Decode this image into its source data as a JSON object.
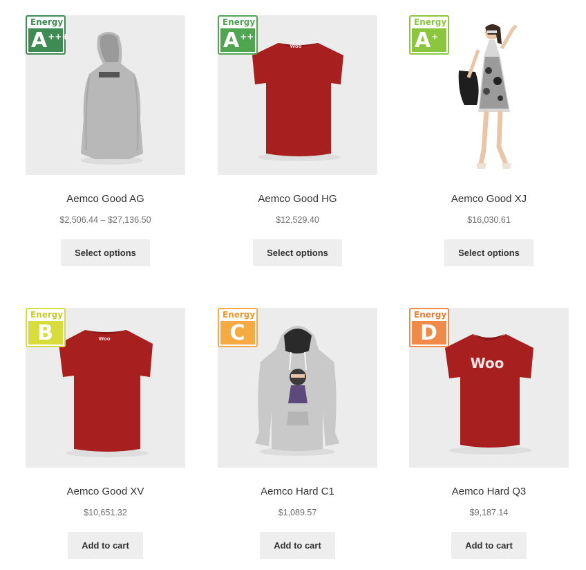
{
  "products": [
    {
      "name": "Aemco Good AG",
      "price": "$2,506.44 – $27,136.50",
      "button": "Select options",
      "energy_word": "Energy",
      "energy_class": "A",
      "energy_plus": "+++",
      "badge_color": "#3e8c53",
      "image": "grey-hoodie-back-icon"
    },
    {
      "name": "Aemco Good HG",
      "price": "$12,529.40",
      "button": "Select options",
      "energy_word": "Energy",
      "energy_class": "A",
      "energy_plus": "++",
      "badge_color": "#4fa550",
      "image": "red-tshirt-back-icon"
    },
    {
      "name": "Aemco Good XJ",
      "price": "$16,030.61",
      "button": "Select options",
      "energy_word": "Energy",
      "energy_class": "A",
      "energy_plus": "+",
      "badge_color": "#8cc63f",
      "image": "model-dress-icon"
    },
    {
      "name": "Aemco Good XV",
      "price": "$10,651.32",
      "button": "Add to cart",
      "energy_word": "Energy",
      "energy_class": "B",
      "energy_plus": "",
      "badge_color": "#d7de3c",
      "image": "red-tshirt-back-icon"
    },
    {
      "name": "Aemco Hard C1",
      "price": "$1,089.57",
      "button": "Add to cart",
      "energy_word": "Energy",
      "energy_class": "C",
      "energy_plus": "",
      "badge_color": "#f7a944",
      "image": "grey-hoodie-ninja-icon"
    },
    {
      "name": "Aemco Hard Q3",
      "price": "$9,187.14",
      "button": "Add to cart",
      "energy_word": "Energy",
      "energy_class": "D",
      "energy_plus": "",
      "badge_color": "#ef8a4a",
      "image": "red-tshirt-woo-icon"
    }
  ],
  "shirt_logo": "Woo"
}
